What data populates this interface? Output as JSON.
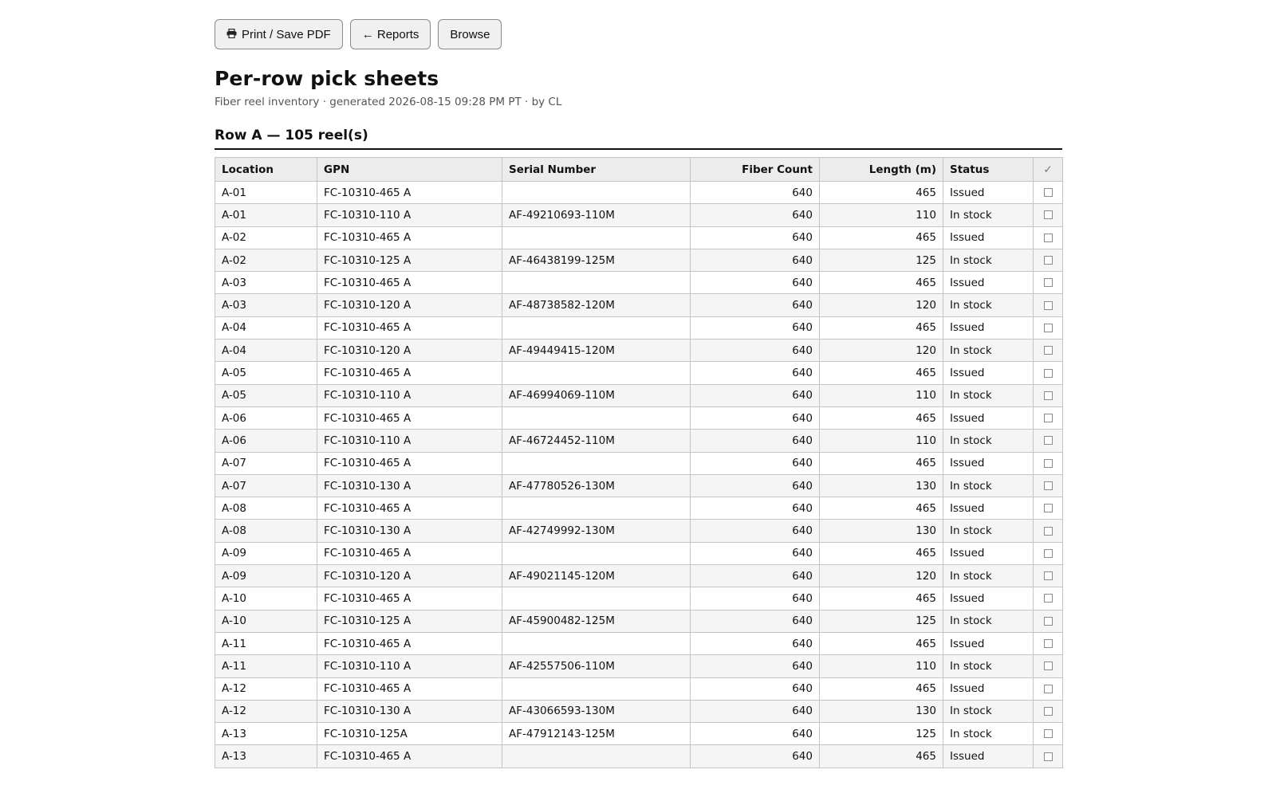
{
  "toolbar": {
    "print_label": "Print / Save PDF",
    "reports_label": "← Reports",
    "browse_label": "Browse"
  },
  "page_title": "Per-row pick sheets",
  "subtitle": "Fiber reel inventory · generated 2026-08-15 09:28 PM PT · by CL",
  "section_title": "Row A — 105 reel(s)",
  "table": {
    "headers": [
      "Location",
      "GPN",
      "Serial Number",
      "Fiber Count",
      "Length (m)",
      "Status",
      "✓"
    ],
    "rows": [
      [
        "A-01",
        "FC-10310-465 A",
        "",
        "640",
        "465",
        "Issued"
      ],
      [
        "A-01",
        "FC-10310-110 A",
        "AF-49210693-110M",
        "640",
        "110",
        "In stock"
      ],
      [
        "A-02",
        "FC-10310-465 A",
        "",
        "640",
        "465",
        "Issued"
      ],
      [
        "A-02",
        "FC-10310-125 A",
        "AF-46438199-125M",
        "640",
        "125",
        "In stock"
      ],
      [
        "A-03",
        "FC-10310-465 A",
        "",
        "640",
        "465",
        "Issued"
      ],
      [
        "A-03",
        "FC-10310-120 A",
        "AF-48738582-120M",
        "640",
        "120",
        "In stock"
      ],
      [
        "A-04",
        "FC-10310-465 A",
        "",
        "640",
        "465",
        "Issued"
      ],
      [
        "A-04",
        "FC-10310-120 A",
        "AF-49449415-120M",
        "640",
        "120",
        "In stock"
      ],
      [
        "A-05",
        "FC-10310-465 A",
        "",
        "640",
        "465",
        "Issued"
      ],
      [
        "A-05",
        "FC-10310-110 A",
        "AF-46994069-110M",
        "640",
        "110",
        "In stock"
      ],
      [
        "A-06",
        "FC-10310-465 A",
        "",
        "640",
        "465",
        "Issued"
      ],
      [
        "A-06",
        "FC-10310-110 A",
        "AF-46724452-110M",
        "640",
        "110",
        "In stock"
      ],
      [
        "A-07",
        "FC-10310-465 A",
        "",
        "640",
        "465",
        "Issued"
      ],
      [
        "A-07",
        "FC-10310-130 A",
        "AF-47780526-130M",
        "640",
        "130",
        "In stock"
      ],
      [
        "A-08",
        "FC-10310-465 A",
        "",
        "640",
        "465",
        "Issued"
      ],
      [
        "A-08",
        "FC-10310-130 A",
        "AF-42749992-130M",
        "640",
        "130",
        "In stock"
      ],
      [
        "A-09",
        "FC-10310-465 A",
        "",
        "640",
        "465",
        "Issued"
      ],
      [
        "A-09",
        "FC-10310-120 A",
        "AF-49021145-120M",
        "640",
        "120",
        "In stock"
      ],
      [
        "A-10",
        "FC-10310-465 A",
        "",
        "640",
        "465",
        "Issued"
      ],
      [
        "A-10",
        "FC-10310-125 A",
        "AF-45900482-125M",
        "640",
        "125",
        "In stock"
      ],
      [
        "A-11",
        "FC-10310-465 A",
        "",
        "640",
        "465",
        "Issued"
      ],
      [
        "A-11",
        "FC-10310-110 A",
        "AF-42557506-110M",
        "640",
        "110",
        "In stock"
      ],
      [
        "A-12",
        "FC-10310-465 A",
        "",
        "640",
        "465",
        "Issued"
      ],
      [
        "A-12",
        "FC-10310-130 A",
        "AF-43066593-130M",
        "640",
        "130",
        "In stock"
      ],
      [
        "A-13",
        "FC-10310-125A",
        "AF-47912143-125M",
        "640",
        "125",
        "In stock"
      ],
      [
        "A-13",
        "FC-10310-465 A",
        "",
        "640",
        "465",
        "Issued"
      ]
    ]
  }
}
